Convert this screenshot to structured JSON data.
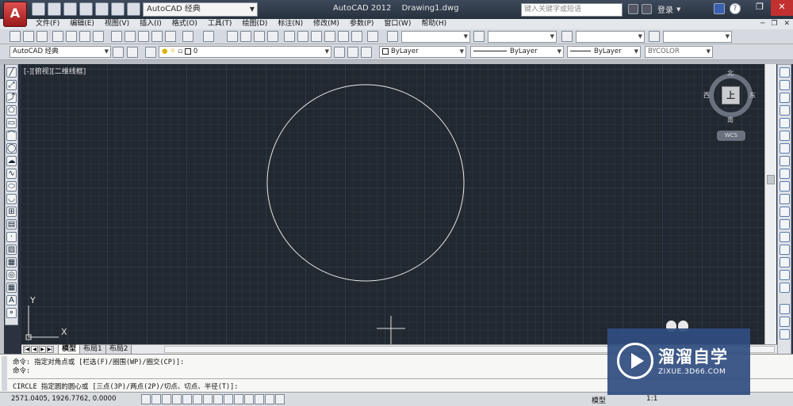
{
  "titlebar": {
    "app_button": "A",
    "workspace": "AutoCAD 经典",
    "app_title": "AutoCAD 2012",
    "doc_title": "Drawing1.dwg",
    "search_placeholder": "键入关键字或短语",
    "login": "登录",
    "help": "?"
  },
  "menu": {
    "items": [
      "文件(F)",
      "编辑(E)",
      "视图(V)",
      "插入(I)",
      "格式(O)",
      "工具(T)",
      "绘图(D)",
      "标注(N)",
      "修改(M)",
      "参数(P)",
      "窗口(W)",
      "帮助(H)"
    ]
  },
  "toolbar": {
    "workspace_dropdown": "AutoCAD 经典",
    "layer_dropdown": "0",
    "color_dropdown": "ByLayer",
    "linetype_dropdown": "ByLayer",
    "lineweight_dropdown": "ByLayer",
    "plotstyle_dropdown": "BYCOLOR"
  },
  "viewport": {
    "label": "[-][俯视][二维线框]"
  },
  "viewcube": {
    "north": "北",
    "south": "南",
    "east": "东",
    "west": "西",
    "face": "上",
    "wcs": "WCS"
  },
  "ucs": {
    "x_label": "X",
    "y_label": "Y"
  },
  "layout_tabs": [
    "模型",
    "布局1",
    "布局2"
  ],
  "command": {
    "line1": "命令: 指定对角点或 [栏选(F)/圈围(WP)/圈交(CP)]:",
    "line2": "命令:",
    "prompt": "CIRCLE 指定圆的圆心或 [三点(3P)/两点(2P)/切点、切点、半径(T)]:"
  },
  "status": {
    "coordinates": "2571.0405, 1926.7762, 0.0000",
    "model": "模型",
    "scale": "1:1"
  },
  "watermark": {
    "title": "溜溜自学",
    "url": "ZIXUE.3D66.COM"
  }
}
